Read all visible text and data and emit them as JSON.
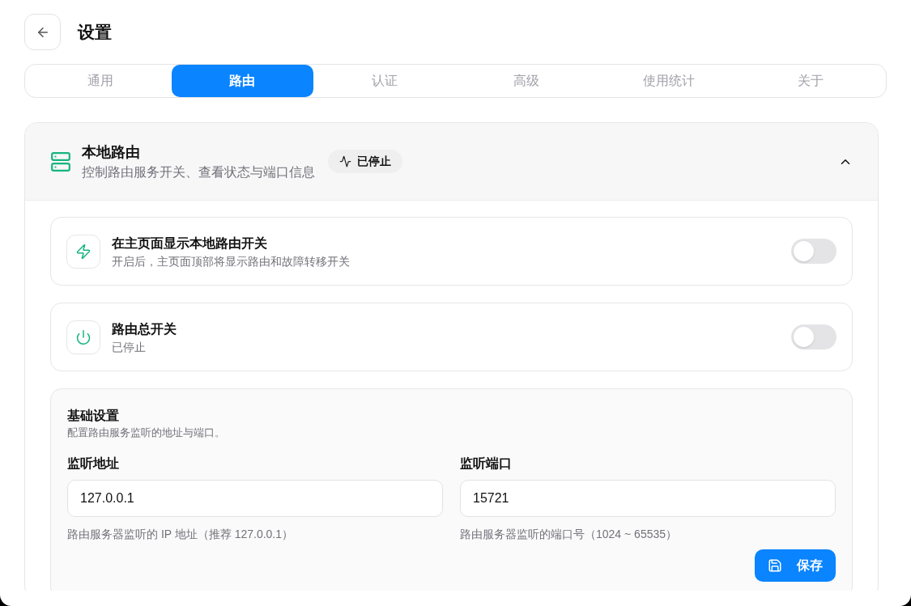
{
  "header": {
    "title": "设置"
  },
  "tabs": [
    {
      "label": "通用",
      "selected": false
    },
    {
      "label": "路由",
      "selected": true
    },
    {
      "label": "认证",
      "selected": false
    },
    {
      "label": "高级",
      "selected": false
    },
    {
      "label": "使用统计",
      "selected": false
    },
    {
      "label": "关于",
      "selected": false
    }
  ],
  "section": {
    "title": "本地路由",
    "subtitle": "控制路由服务开关、查看状态与端口信息",
    "status": "已停止",
    "expanded": true,
    "toggles": [
      {
        "kind": "bolt",
        "title": "在主页面显示本地路由开关",
        "description": "开启后，主页面顶部将显示路由和故障转移开关",
        "on": false
      },
      {
        "kind": "power",
        "title": "路由总开关",
        "description": "已停止",
        "on": false
      }
    ],
    "basic": {
      "title": "基础设置",
      "description": "配置路由服务监听的地址与端口。",
      "fields": [
        {
          "label": "监听地址",
          "value": "127.0.0.1",
          "hint": "路由服务器监听的 IP 地址（推荐 127.0.0.1）"
        },
        {
          "label": "监听端口",
          "value": "15721",
          "hint": "路由服务器监听的端口号（1024 ~ 65535）"
        }
      ],
      "save": "保存"
    }
  }
}
